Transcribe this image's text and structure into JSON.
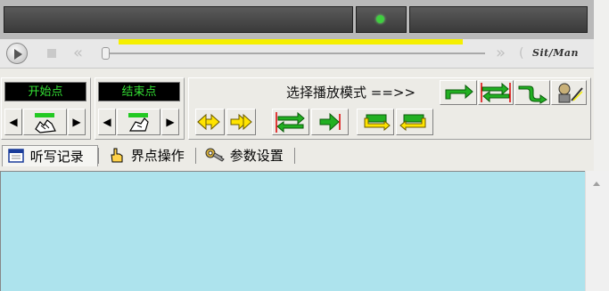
{
  "transport": {
    "brand": "Sit/Man",
    "progress_bar_percent": 0,
    "rewind": "«",
    "forward": "»",
    "forward_partial": "("
  },
  "points": {
    "start_label": "开始点",
    "end_label": "结束点",
    "prev": "◀",
    "next": "▶"
  },
  "mode": {
    "label": "选择播放模式 ==>>"
  },
  "tabs": [
    {
      "label": "听写记录",
      "icon": "notebook-icon",
      "active": true
    },
    {
      "label": "界点操作",
      "icon": "hand-pointer-icon",
      "active": false
    },
    {
      "label": "参数设置",
      "icon": "key-icon",
      "active": false
    }
  ],
  "colors": {
    "content_bg": "#ade3ed",
    "lcd_text": "#34e034",
    "progress_yellow": "#f5ef00",
    "arrow_green": "#22b022",
    "arrow_yellow": "#ffe400"
  }
}
